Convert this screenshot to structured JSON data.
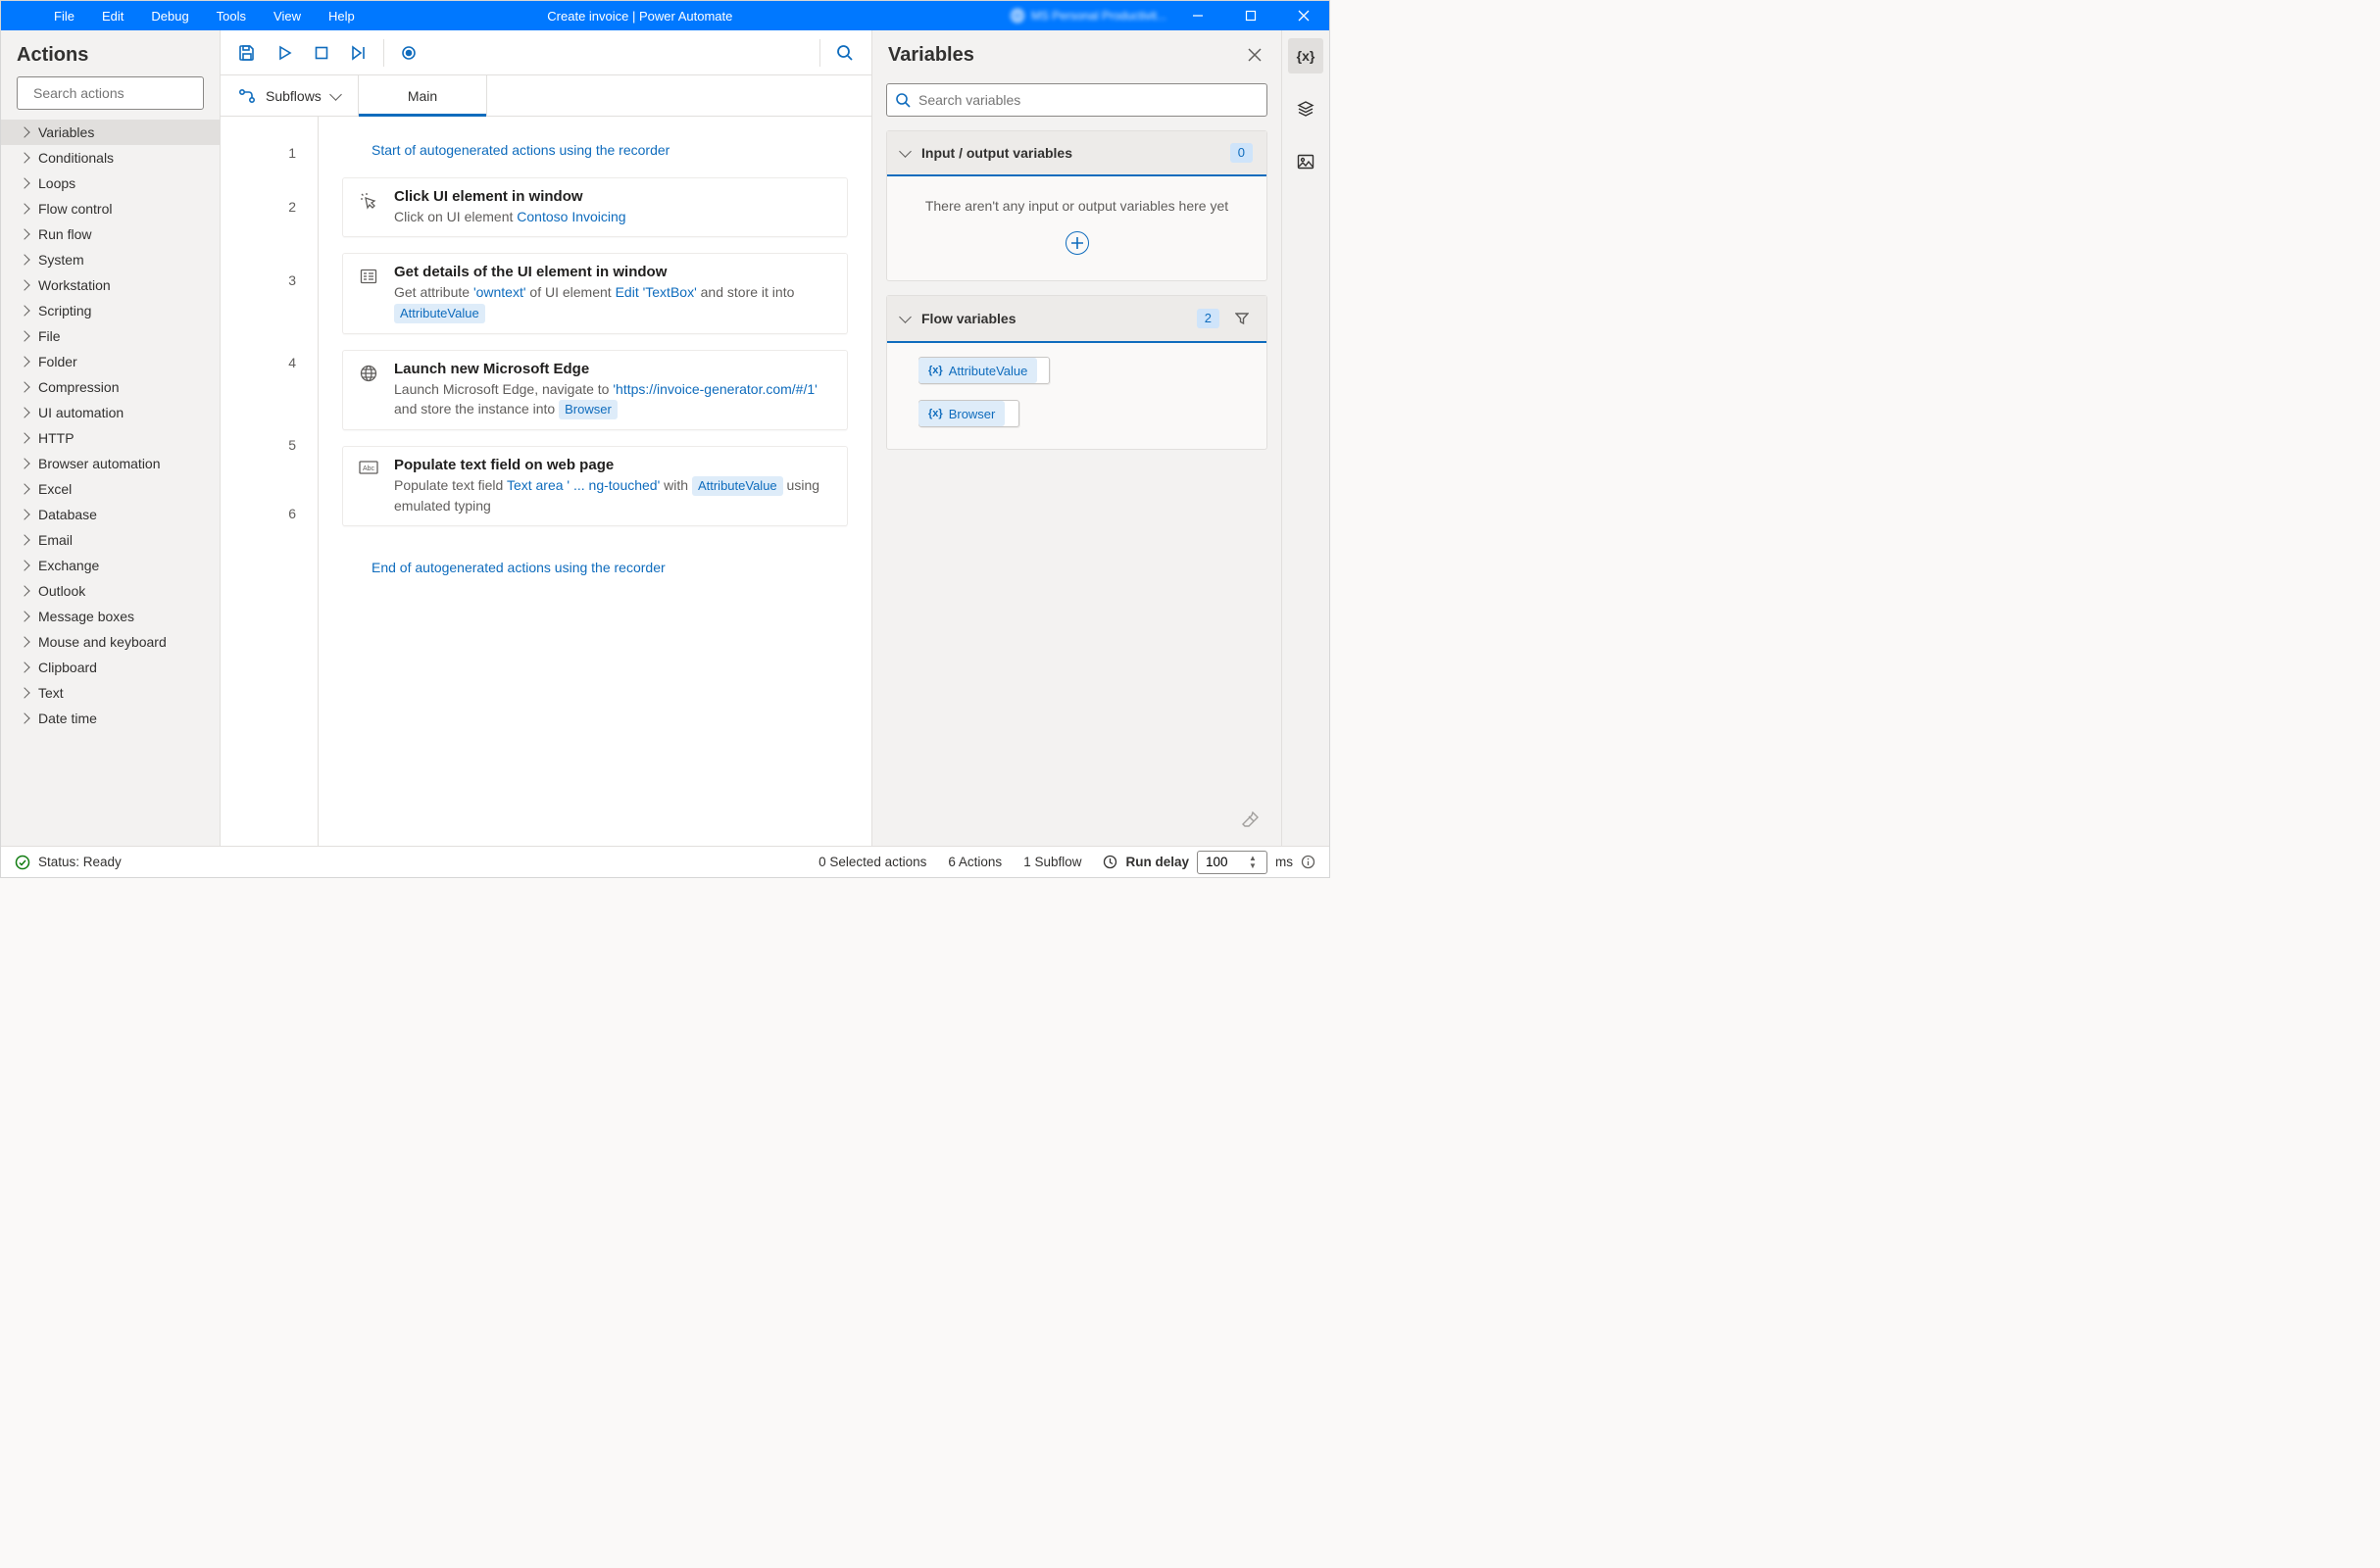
{
  "titlebar": {
    "menu": [
      "File",
      "Edit",
      "Debug",
      "Tools",
      "View",
      "Help"
    ],
    "title": "Create invoice | Power Automate",
    "user": "MS Personal Productivit..."
  },
  "actions": {
    "title": "Actions",
    "search_placeholder": "Search actions",
    "items": [
      "Variables",
      "Conditionals",
      "Loops",
      "Flow control",
      "Run flow",
      "System",
      "Workstation",
      "Scripting",
      "File",
      "Folder",
      "Compression",
      "UI automation",
      "HTTP",
      "Browser automation",
      "Excel",
      "Database",
      "Email",
      "Exchange",
      "Outlook",
      "Message boxes",
      "Mouse and keyboard",
      "Clipboard",
      "Text",
      "Date time"
    ]
  },
  "tabs": {
    "subflows": "Subflows",
    "main": "Main"
  },
  "steps": {
    "banner_start": "Start of autogenerated actions using the recorder",
    "banner_end": "End of autogenerated actions using the recorder",
    "items": [
      {
        "title": "Click UI element in window",
        "desc_prefix": "Click on UI element ",
        "link1": "Contoso Invoicing"
      },
      {
        "title": "Get details of the UI element in window",
        "desc_parts": [
          "Get attribute ",
          "'owntext'",
          " of UI element ",
          "Edit 'TextBox'",
          " and store it into "
        ],
        "chip": "AttributeValue"
      },
      {
        "title": "Launch new Microsoft Edge",
        "desc_parts": [
          "Launch Microsoft Edge, navigate to ",
          "'https://invoice-generator.com/#/1'",
          " and store the instance into "
        ],
        "chip": "Browser"
      },
      {
        "title": "Populate text field on web page",
        "desc_parts": [
          "Populate text field ",
          "Text area ' ...  ng-touched'",
          " with "
        ],
        "chip": "AttributeValue",
        "desc_suffix": " using emulated typing"
      }
    ]
  },
  "variables": {
    "title": "Variables",
    "search_placeholder": "Search variables",
    "io": {
      "title": "Input / output variables",
      "count": "0",
      "empty": "There aren't any input or output variables here yet"
    },
    "flow": {
      "title": "Flow variables",
      "count": "2",
      "items": [
        "AttributeValue",
        "Browser"
      ]
    }
  },
  "statusbar": {
    "status": "Status: Ready",
    "selected": "0 Selected actions",
    "actions": "6 Actions",
    "subflows": "1 Subflow",
    "rundelay_label": "Run delay",
    "rundelay_value": "100",
    "rundelay_unit": "ms"
  }
}
